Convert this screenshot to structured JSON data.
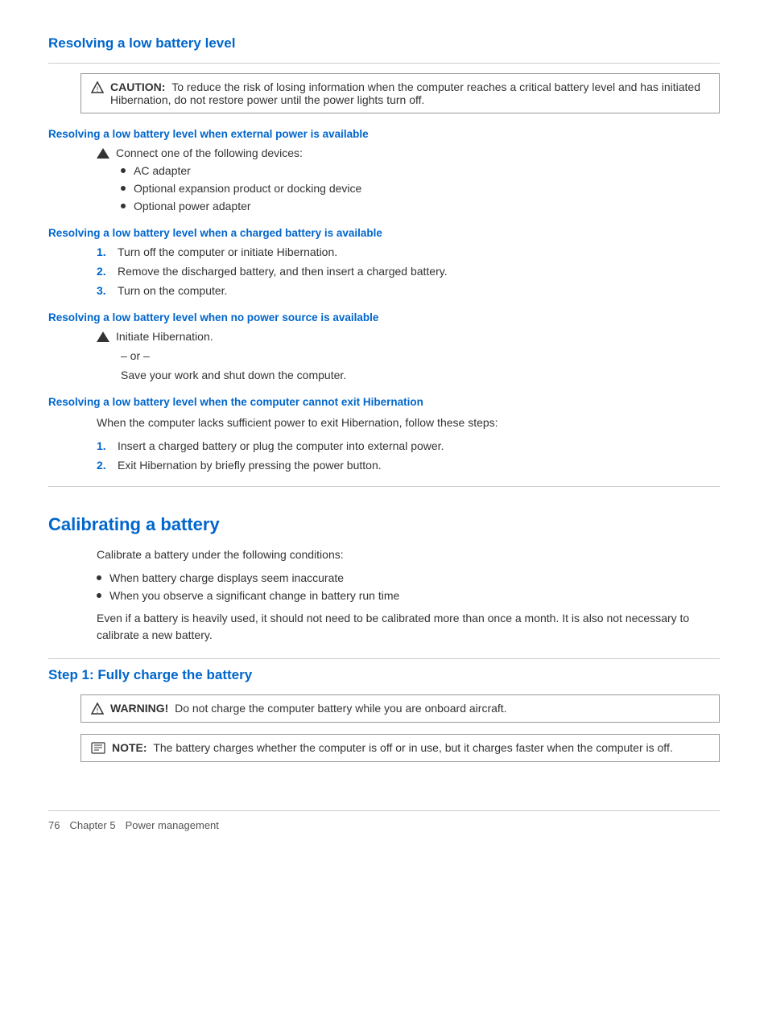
{
  "page": {
    "main_section_title": "Resolving a low battery level",
    "caution": {
      "label": "CAUTION:",
      "text": "To reduce the risk of losing information when the computer reaches a critical battery level and has initiated Hibernation, do not restore power until the power lights turn off."
    },
    "subsections": [
      {
        "id": "external-power",
        "heading": "Resolving a low battery level when external power is available",
        "content_type": "arrow_bullet",
        "arrow_text": "Connect one of the following devices:",
        "bullets": [
          "AC adapter",
          "Optional expansion product or docking device",
          "Optional power adapter"
        ]
      },
      {
        "id": "charged-battery",
        "heading": "Resolving a low battery level when a charged battery is available",
        "content_type": "numbered",
        "steps": [
          "Turn off the computer or initiate Hibernation.",
          "Remove the discharged battery, and then insert a charged battery.",
          "Turn on the computer."
        ]
      },
      {
        "id": "no-power-source",
        "heading": "Resolving a low battery level when no power source is available",
        "content_type": "arrow_or",
        "arrow_text": "Initiate Hibernation.",
        "or_label": "– or –",
        "or_text": "Save your work and shut down the computer."
      },
      {
        "id": "cannot-exit",
        "heading": "Resolving a low battery level when the computer cannot exit Hibernation",
        "content_type": "numbered_with_intro",
        "intro": "When the computer lacks sufficient power to exit Hibernation, follow these steps:",
        "steps": [
          "Insert a charged battery or plug the computer into external power.",
          "Exit Hibernation by briefly pressing the power button."
        ]
      }
    ],
    "calibrating_section": {
      "title": "Calibrating a battery",
      "intro": "Calibrate a battery under the following conditions:",
      "bullets": [
        "When battery charge displays seem inaccurate",
        "When you observe a significant change in battery run time"
      ],
      "note_text": "Even if a battery is heavily used, it should not need to be calibrated more than once a month. It is also not necessary to calibrate a new battery."
    },
    "step1_section": {
      "title": "Step 1: Fully charge the battery",
      "warning": {
        "label": "WARNING!",
        "text": "Do not charge the computer battery while you are onboard aircraft."
      },
      "note": {
        "label": "NOTE:",
        "text": "The battery charges whether the computer is off or in use, but it charges faster when the computer is off."
      }
    },
    "footer": {
      "page_number": "76",
      "chapter": "Chapter 5",
      "chapter_title": "Power management"
    }
  }
}
